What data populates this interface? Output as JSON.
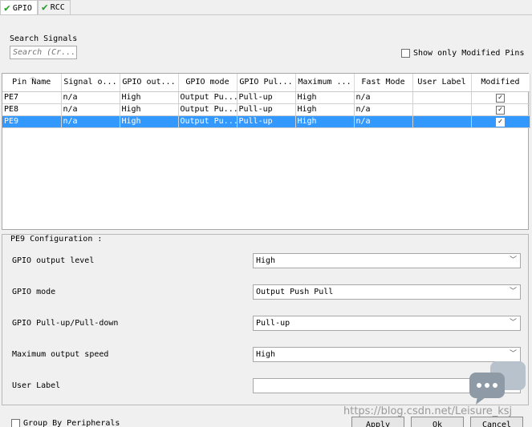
{
  "tabs": [
    {
      "label": "GPIO"
    },
    {
      "label": "RCC"
    }
  ],
  "search": {
    "label": "Search Signals",
    "placeholder": "Search (Cr..."
  },
  "show_modified": {
    "label": "Show only Modified Pins",
    "checked": false
  },
  "table": {
    "columns": [
      "Pin Name",
      "Signal o...",
      "GPIO out...",
      "GPIO mode",
      "GPIO Pul...",
      "Maximum ...",
      "Fast Mode",
      "User Label",
      "Modified"
    ],
    "rows": [
      {
        "pin": "PE7",
        "signal": "n/a",
        "output": "High",
        "mode": "Output Pu...",
        "pull": "Pull-up",
        "speed": "High",
        "fast": "n/a",
        "label": "",
        "modified": true
      },
      {
        "pin": "PE8",
        "signal": "n/a",
        "output": "High",
        "mode": "Output Pu...",
        "pull": "Pull-up",
        "speed": "High",
        "fast": "n/a",
        "label": "",
        "modified": true
      },
      {
        "pin": "PE9",
        "signal": "n/a",
        "output": "High",
        "mode": "Output Pu...",
        "pull": "Pull-up",
        "speed": "High",
        "fast": "n/a",
        "label": "",
        "modified": true
      }
    ],
    "selected_row": "PE9"
  },
  "config": {
    "title": "PE9 Configuration :",
    "fields": [
      {
        "label": "GPIO output level",
        "value": "High"
      },
      {
        "label": "GPIO mode",
        "value": "Output Push Pull"
      },
      {
        "label": "GPIO Pull-up/Pull-down",
        "value": "Pull-up"
      },
      {
        "label": "Maximum output speed",
        "value": "High"
      },
      {
        "label": "User Label",
        "value": ""
      }
    ]
  },
  "bottom": {
    "group_by_label": "Group By Peripherals",
    "apply_label": "Apply",
    "ok_label": "Ok",
    "cancel_label": "Cancel"
  },
  "watermark": "https://blog.csdn.net/Leisure_ksj",
  "colors": {
    "selection": "#3399ff",
    "check_green": "#2a9d2a"
  }
}
